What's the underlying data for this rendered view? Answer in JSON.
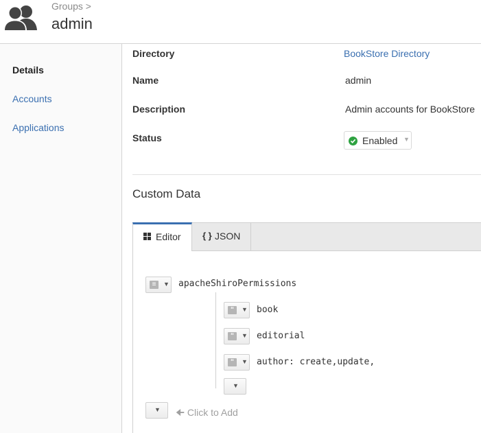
{
  "header": {
    "breadcrumb": "Groups >",
    "title": "admin"
  },
  "sidebar": {
    "items": [
      {
        "label": "Details",
        "active": true
      },
      {
        "label": "Accounts",
        "active": false
      },
      {
        "label": "Applications",
        "active": false
      }
    ]
  },
  "details": {
    "directory_label": "Directory",
    "directory_value": "BookStore Directory",
    "name_label": "Name",
    "name_value": "admin",
    "description_label": "Description",
    "description_value": "Admin accounts for BookStore",
    "status_label": "Status",
    "status_value": "Enabled"
  },
  "custom_data": {
    "title": "Custom Data",
    "tabs": [
      {
        "label": "Editor",
        "icon": "grid-icon",
        "active": true
      },
      {
        "label": "JSON",
        "icon": "braces-icon",
        "active": false
      }
    ],
    "json_braces": "{ }",
    "tree": {
      "root_key": "apacheShiroPermissions",
      "items": [
        "book",
        "editorial",
        "author: create,update,"
      ]
    },
    "click_to_add": "Click to Add"
  },
  "colors": {
    "link": "#3a6fb0",
    "status_ok": "#2ea241",
    "tab_accent": "#3a6fb0"
  }
}
